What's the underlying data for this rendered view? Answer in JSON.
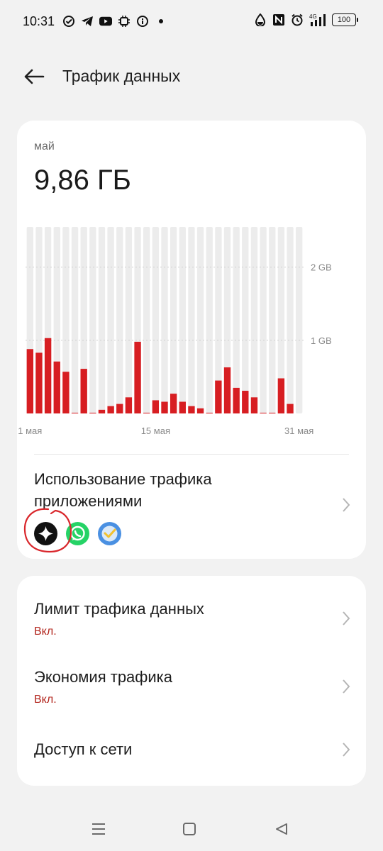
{
  "status_bar": {
    "time": "10:31",
    "left_icons": [
      "check-circle-icon",
      "telegram-icon",
      "youtube-icon",
      "chip-icon",
      "info-icon",
      "dot-icon"
    ],
    "right_icons": [
      "water-drop-icon",
      "nfc-icon",
      "alarm-icon",
      "signal-4g-icon"
    ],
    "network": "4G",
    "battery": "100"
  },
  "header": {
    "title": "Трафик данных",
    "back_icon": "arrow-left-icon"
  },
  "usage_card": {
    "period_label": "май",
    "total": "9,86 ГБ"
  },
  "chart_data": {
    "type": "bar",
    "x": [
      "1",
      "2",
      "3",
      "4",
      "5",
      "6",
      "7",
      "8",
      "9",
      "10",
      "11",
      "12",
      "13",
      "14",
      "15",
      "16",
      "17",
      "18",
      "19",
      "20",
      "21",
      "22",
      "23",
      "24",
      "25",
      "26",
      "27",
      "28",
      "29",
      "30",
      "31"
    ],
    "values": [
      0.88,
      0.83,
      1.03,
      0.71,
      0.57,
      0.01,
      0.61,
      0.01,
      0.05,
      0.1,
      0.13,
      0.22,
      0.98,
      0.01,
      0.18,
      0.16,
      0.27,
      0.16,
      0.1,
      0.07,
      0.01,
      0.45,
      0.63,
      0.35,
      0.31,
      0.22,
      0.01,
      0.01,
      0.48,
      0.13
    ],
    "unit": "GB",
    "yticks": [
      {
        "value": 1,
        "label": "1 GB"
      },
      {
        "value": 2,
        "label": "2 GB"
      }
    ],
    "ylim": [
      0,
      2.55
    ],
    "xticks": [
      {
        "index": 0,
        "label": "1 мая"
      },
      {
        "index": 14,
        "label": "15 мая"
      },
      {
        "index": 30,
        "label": "31 мая"
      }
    ],
    "colors": {
      "bar": "#d71e22",
      "track": "#ececec",
      "grid": "#cfcfcf"
    }
  },
  "apps_usage": {
    "title": "Использование трафика приложениями",
    "icons": [
      "browser-star-icon",
      "whatsapp-icon",
      "checkmark-app-icon"
    ],
    "annotation_color": "#d9262b"
  },
  "settings": {
    "items": [
      {
        "title": "Лимит трафика данных",
        "subtitle": "Вкл."
      },
      {
        "title": "Экономия трафика",
        "subtitle": "Вкл."
      },
      {
        "title": "Доступ к сети"
      }
    ]
  },
  "nav_bar": {
    "icons": [
      "menu-icon",
      "home-icon",
      "back-triangle-icon"
    ]
  },
  "colors": {
    "background": "#f2f2f2",
    "card": "#ffffff",
    "accent_red": "#b3261e"
  }
}
